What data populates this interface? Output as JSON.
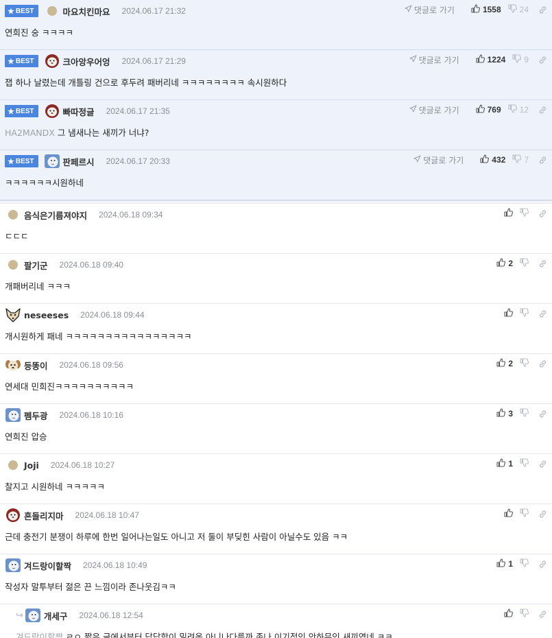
{
  "best_badge": "BEST",
  "goto_label": "댓글로 가기",
  "best_comments": [
    {
      "avatar": "avatar-plain",
      "nick": "마요치킨마요",
      "date": "2024.06.17 21:32",
      "mention": "",
      "text": "연희진 숭 ㅋㅋㅋㅋ",
      "up": "1558",
      "down": "24"
    },
    {
      "avatar": "avatar-red",
      "nick": "크아앙우어엉",
      "date": "2024.06.17 21:29",
      "mention": "",
      "text": "잽 하나 날렸는데 개틀링 건으로 후두려 패버리네 ㅋㅋㅋㅋㅋㅋㅋㅋ 속시원하다",
      "up": "1224",
      "down": "9"
    },
    {
      "avatar": "avatar-red",
      "nick": "빠따정글",
      "date": "2024.06.17 21:35",
      "mention": "HA2MANDX",
      "text": "그 냄새나는 새끼가 너냐?",
      "up": "769",
      "down": "12"
    },
    {
      "avatar": "avatar-blue",
      "nick": "판페르시",
      "date": "2024.06.17 20:33",
      "mention": "",
      "text": "ㅋㅋㅋㅋㅋㅋ시원하네",
      "up": "432",
      "down": "7"
    }
  ],
  "comments": [
    {
      "avatar": "avatar-plain",
      "nick": "음식은기름져야지",
      "date": "2024.06.18 09:34",
      "mention": "",
      "text": "ㄷㄷㄷ",
      "up": "",
      "down": ""
    },
    {
      "avatar": "avatar-plain",
      "nick": "팔기군",
      "date": "2024.06.18 09:40",
      "mention": "",
      "text": "개패버리네 ㅋㅋㅋ",
      "up": "2",
      "down": ""
    },
    {
      "avatar": "avatar-fox",
      "nick": "neseeses",
      "date": "2024.06.18 09:44",
      "mention": "",
      "text": "개시원하게 패네 ㅋㅋㅋㅋㅋㅋㅋㅋㅋㅋㅋㅋㅋㅋㅋㅋ",
      "up": "",
      "down": ""
    },
    {
      "avatar": "avatar-dog",
      "nick": "등똥이",
      "date": "2024.06.18 09:56",
      "mention": "",
      "text": "연세대 민희진ㅋㅋㅋㅋㅋㅋㅋㅋㅋㅋ",
      "up": "2",
      "down": ""
    },
    {
      "avatar": "avatar-blue",
      "nick": "펨두광",
      "date": "2024.06.18 10:16",
      "mention": "",
      "text": "연희진 압승",
      "up": "3",
      "down": ""
    },
    {
      "avatar": "avatar-plain",
      "nick": "Joji",
      "date": "2024.06.18 10:27",
      "mention": "",
      "text": "찰지고 시원하네 ㅋㅋㅋㅋㅋ",
      "up": "1",
      "down": ""
    },
    {
      "avatar": "avatar-red",
      "nick": "흔들리지마",
      "date": "2024.06.18 10:47",
      "mention": "",
      "text": "근데 충전기 분쟁이 하루에 한번 일어나는일도 아니고 저 둘이 부딪힌 사람이 아닐수도 있음 ㅋㅋ",
      "up": "",
      "down": ""
    },
    {
      "avatar": "avatar-blue",
      "nick": "겨드랑이할짝",
      "date": "2024.06.18 10:49",
      "mention": "",
      "text": "작성자 말투부터 젊은 끈 느낌이라 존나웃김ㅋㅋ",
      "up": "1",
      "down": ""
    }
  ],
  "reply": {
    "avatar": "avatar-blue",
    "nick": "개세구",
    "date": "2024.06.18 12:54",
    "mention": "겨드랑이할짝",
    "text": "ㄹㅇ 짧은 글에서부터 답답함이 밀려옴 아니나다를까 존나 이기적인 안하무인 새끼였네 ㅋㅋ",
    "up": "",
    "down": ""
  },
  "colors": {
    "best_bg": "#eef2fb",
    "badge": "#4a86e0",
    "meta": "#8a8f97",
    "mention": "#9aa0a8"
  }
}
